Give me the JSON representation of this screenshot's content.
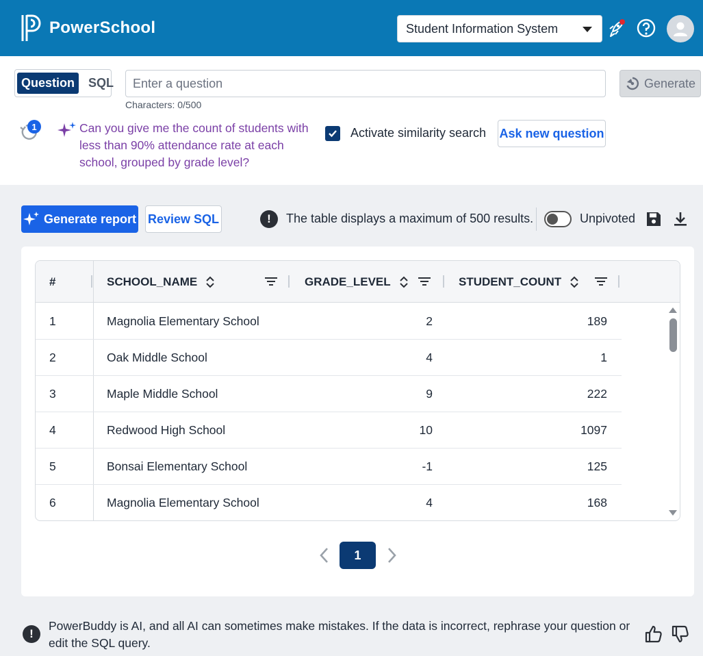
{
  "header": {
    "brand": "PowerSchool",
    "app_select": "Student Information System",
    "icons": [
      "launch-icon",
      "help-icon",
      "user-avatar-icon"
    ],
    "bg_color": "#0a78b5"
  },
  "question": {
    "mode_question": "Question",
    "mode_sql": "SQL",
    "placeholder": "Enter a question",
    "value": "",
    "char_count": "Characters: 0/500",
    "generate": "Generate",
    "history_badge": "1",
    "suggestion": "Can you give me the count of students with less than 90% attendance rate at each school, grouped by grade level?",
    "similarity_label": "Activate similarity search",
    "similarity_checked": true,
    "ask_new": "Ask new question"
  },
  "toolbar": {
    "generate_report": "Generate report",
    "review_sql": "Review SQL",
    "info": "The table displays a maximum of 500 results.",
    "unpivoted_label": "Unpivoted",
    "unpivoted_on": false
  },
  "table": {
    "columns": [
      "#",
      "SCHOOL_NAME",
      "GRADE_LEVEL",
      "STUDENT_COUNT"
    ],
    "rows": [
      [
        "1",
        "Magnolia Elementary School",
        "2",
        "189"
      ],
      [
        "2",
        "Oak Middle School",
        "4",
        "1"
      ],
      [
        "3",
        "Maple Middle School",
        "9",
        "222"
      ],
      [
        "4",
        "Redwood High School",
        "10",
        "1097"
      ],
      [
        "5",
        "Bonsai Elementary School",
        "-1",
        "125"
      ],
      [
        "6",
        "Magnolia Elementary School",
        "4",
        "168"
      ]
    ]
  },
  "pagination": {
    "current": "1"
  },
  "footer": {
    "disclaimer": "PowerBuddy is AI, and all AI can sometimes make mistakes. If the data is incorrect, rephrase your question or edit the SQL query."
  },
  "colors": {
    "primary": "#1a63e6",
    "navy": "#0b3a73",
    "suggestion": "#7a3fa6"
  }
}
